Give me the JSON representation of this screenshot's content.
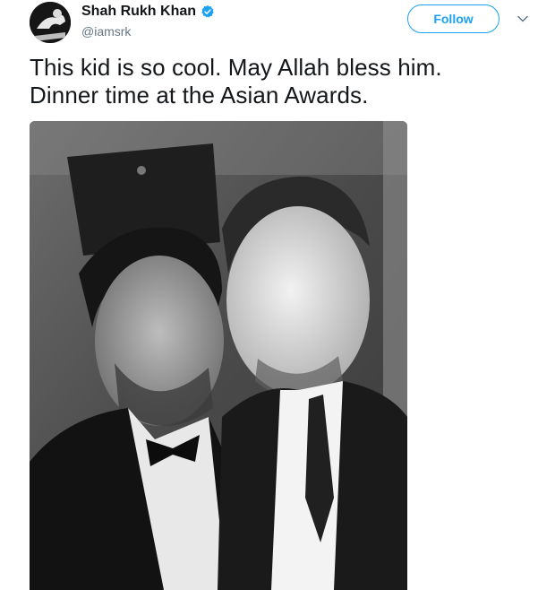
{
  "author": {
    "display_name": "Shah Rukh Khan",
    "handle": "@iamsrk",
    "verified": true
  },
  "follow_button": {
    "label": "Follow",
    "color": "#1da1f2"
  },
  "menu_caret_icon": "chevron-down-icon",
  "tweet": {
    "lines": [
      "This kid is so cool. May Allah bless him.",
      "Dinner time at the Asian Awards."
    ]
  },
  "media": {
    "type": "black-and-white selfie photo"
  }
}
